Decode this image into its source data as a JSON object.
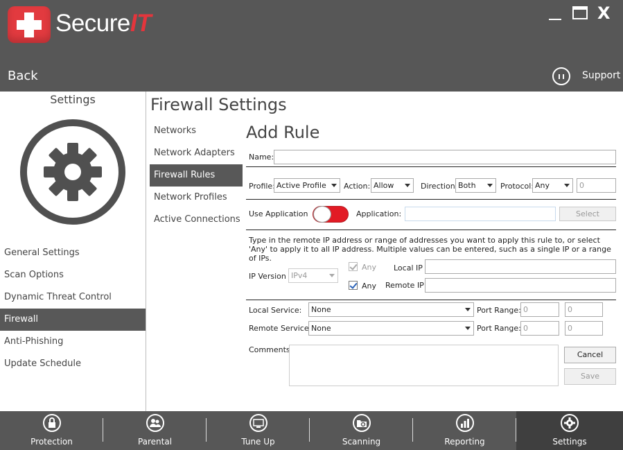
{
  "app": {
    "brand_main": "Secure",
    "brand_accent": "IT",
    "colors": {
      "accent": "#e23a3f",
      "header_bg": "#575757",
      "active_bg": "#585858"
    }
  },
  "window_controls": {
    "minimize_icon": "minimize-icon",
    "maximize_icon": "maximize-icon",
    "close_label": "X"
  },
  "header": {
    "back_label": "Back",
    "support_label": "Support"
  },
  "sidebar": {
    "title": "Settings",
    "items": [
      {
        "label": "General Settings"
      },
      {
        "label": "Scan Options"
      },
      {
        "label": "Dynamic Threat Control"
      },
      {
        "label": "Firewall"
      },
      {
        "label": "Anti-Phishing"
      },
      {
        "label": "Update Schedule"
      }
    ]
  },
  "main": {
    "title": "Firewall Settings",
    "subnav": [
      {
        "label": "Networks"
      },
      {
        "label": "Network Adapters"
      },
      {
        "label": "Firewall Rules"
      },
      {
        "label": "Network Profiles"
      },
      {
        "label": "Active Connections"
      }
    ],
    "section_title": "Add Rule"
  },
  "form": {
    "name_label": "Name:",
    "name_value": "",
    "profile_label": "Profile:",
    "profile_value": "Active Profile",
    "action_label": "Action:",
    "action_value": "Allow",
    "direction_label": "Direction:",
    "direction_value": "Both",
    "protocol_label": "Protocol:",
    "protocol_value": "Any",
    "protocol_number": "0",
    "use_application_label": "Use Application",
    "use_application_on": false,
    "application_label": "Application:",
    "application_value": "",
    "select_button": "Select",
    "description": "Type in the remote IP address or range of addresses you want to apply this rule to, or select 'Any' to apply it to all IP address. Multiple values can be entered, such as a single IP or a range of IPs.",
    "ip_version_label": "IP Version",
    "ip_version_value": "IPv4",
    "any_label_1": "Any",
    "any_label_2": "Any",
    "local_ip_label": "Local IP",
    "remote_ip_label": "Remote IP",
    "local_service_label": "Local Service:",
    "local_service_value": "None",
    "remote_service_label": "Remote Service:",
    "remote_service_value": "None",
    "port_range_label_1": "Port Range:",
    "port_range_label_2": "Port Range:",
    "local_port_from": "0",
    "local_port_to": "0",
    "remote_port_from": "0",
    "remote_port_to": "0",
    "comments_label": "Comments:",
    "cancel_button": "Cancel",
    "save_button": "Save"
  },
  "bottom_nav": [
    {
      "label": "Protection",
      "icon": "lock-icon"
    },
    {
      "label": "Parental",
      "icon": "users-icon"
    },
    {
      "label": "Tune Up",
      "icon": "monitor-icon"
    },
    {
      "label": "Scanning",
      "icon": "folder-search-icon"
    },
    {
      "label": "Reporting",
      "icon": "bar-chart-icon"
    },
    {
      "label": "Settings",
      "icon": "gear-icon"
    }
  ]
}
